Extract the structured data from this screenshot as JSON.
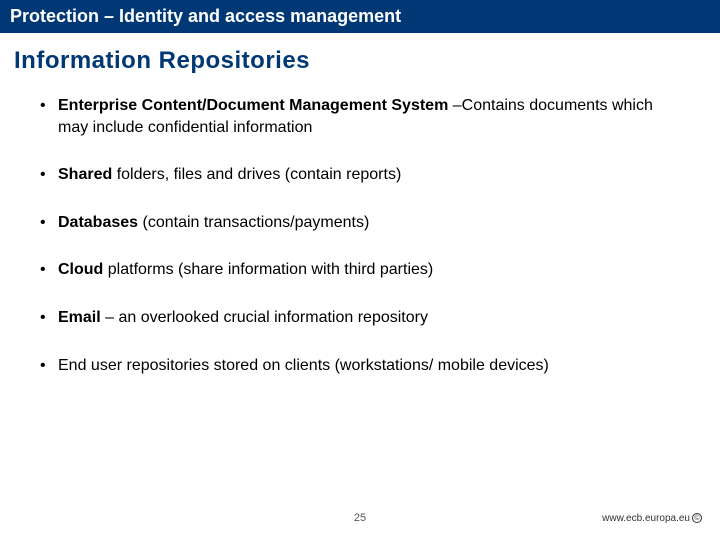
{
  "header": {
    "title": "Protection – Identity and access management"
  },
  "section": {
    "title": "Information Repositories"
  },
  "bullets": [
    {
      "bold": "Enterprise Content/Document Management System ",
      "rest": "–Contains documents which may include confidential information"
    },
    {
      "bold": "Shared",
      "rest": " folders, files and drives (contain reports)"
    },
    {
      "bold": "Databases",
      "rest": " (contain transactions/payments)"
    },
    {
      "bold": "Cloud",
      "rest": " platforms (share information with third parties)"
    },
    {
      "bold": "Email",
      "rest": " – an overlooked crucial information repository"
    },
    {
      "bold": "",
      "rest": "End user repositories stored on clients (workstations/ mobile devices)"
    }
  ],
  "footer": {
    "page": "25",
    "site": "www.ecb.europa.eu",
    "mark": "©"
  }
}
